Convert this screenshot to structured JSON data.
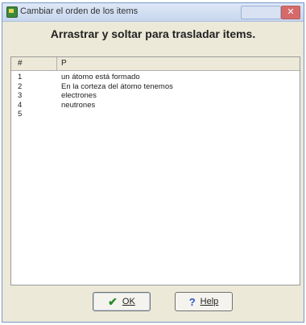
{
  "window": {
    "title": "Cambiar el orden de los items",
    "close_glyph": "✕"
  },
  "header": {
    "text": "Arrastrar y soltar para trasladar items."
  },
  "table": {
    "columns": [
      "#",
      "P"
    ],
    "rows": [
      {
        "num": "1",
        "text": "un átomo está formado"
      },
      {
        "num": "2",
        "text": "En la corteza del átomo tenemos"
      },
      {
        "num": "3",
        "text": "electrones"
      },
      {
        "num": "4",
        "text": "neutrones"
      },
      {
        "num": "5",
        "text": ""
      }
    ]
  },
  "buttons": {
    "ok_label": "OK",
    "help_label": "Help"
  },
  "icons": {
    "ok": "check-icon",
    "help": "help-icon",
    "app": "app-icon"
  }
}
